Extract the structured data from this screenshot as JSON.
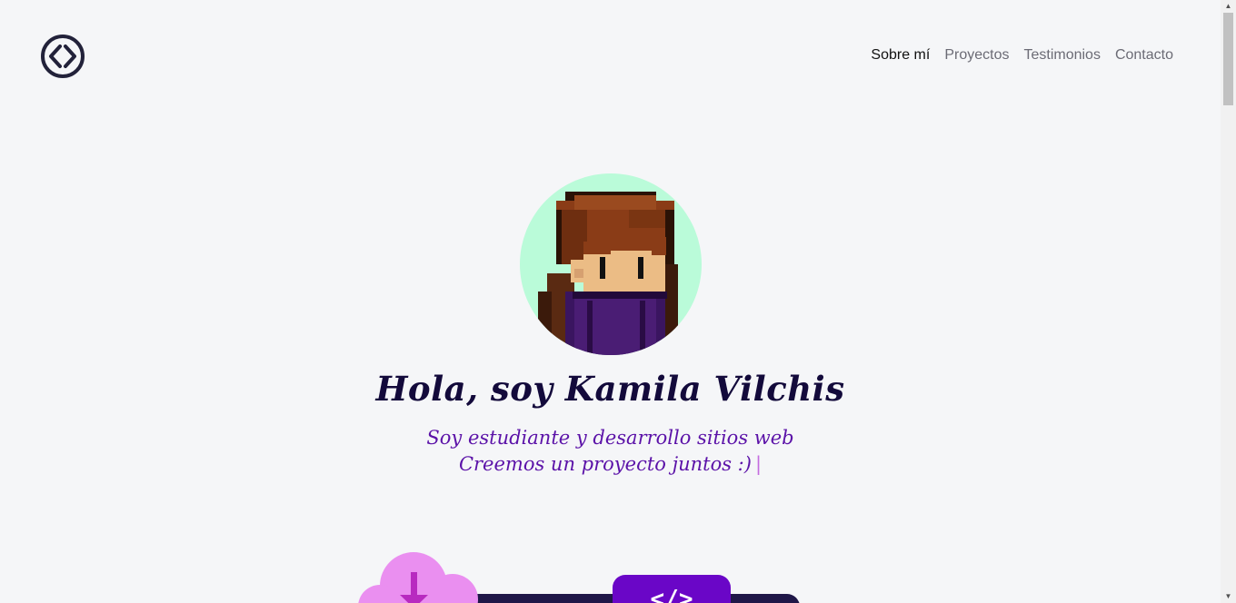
{
  "header": {
    "logo_icon": "code-brackets-circle-icon",
    "nav": [
      {
        "label": "Sobre mí",
        "active": true
      },
      {
        "label": "Proyectos",
        "active": false
      },
      {
        "label": "Testimonios",
        "active": false
      },
      {
        "label": "Contacto",
        "active": false
      }
    ]
  },
  "hero": {
    "avatar_icon": "pixel-art-avatar",
    "title": "Hola, soy Kamila Vilchis",
    "subtitle_line1": "Soy estudiante y desarrollo sitios web",
    "subtitle_line2": "Creemos un proyecto juntos :)",
    "caret": "|"
  },
  "illustration": {
    "cloud_icon": "cloud-download-icon",
    "code_icon": "code-tag-icon",
    "code_text": "</>"
  },
  "colors": {
    "background": "#f5f6f8",
    "title": "#130a3b",
    "subtitle": "#5b12a8",
    "avatar_bg": "#bafbd9",
    "accent_purple": "#6a06c7",
    "cloud_pink": "#ea8ff0"
  }
}
